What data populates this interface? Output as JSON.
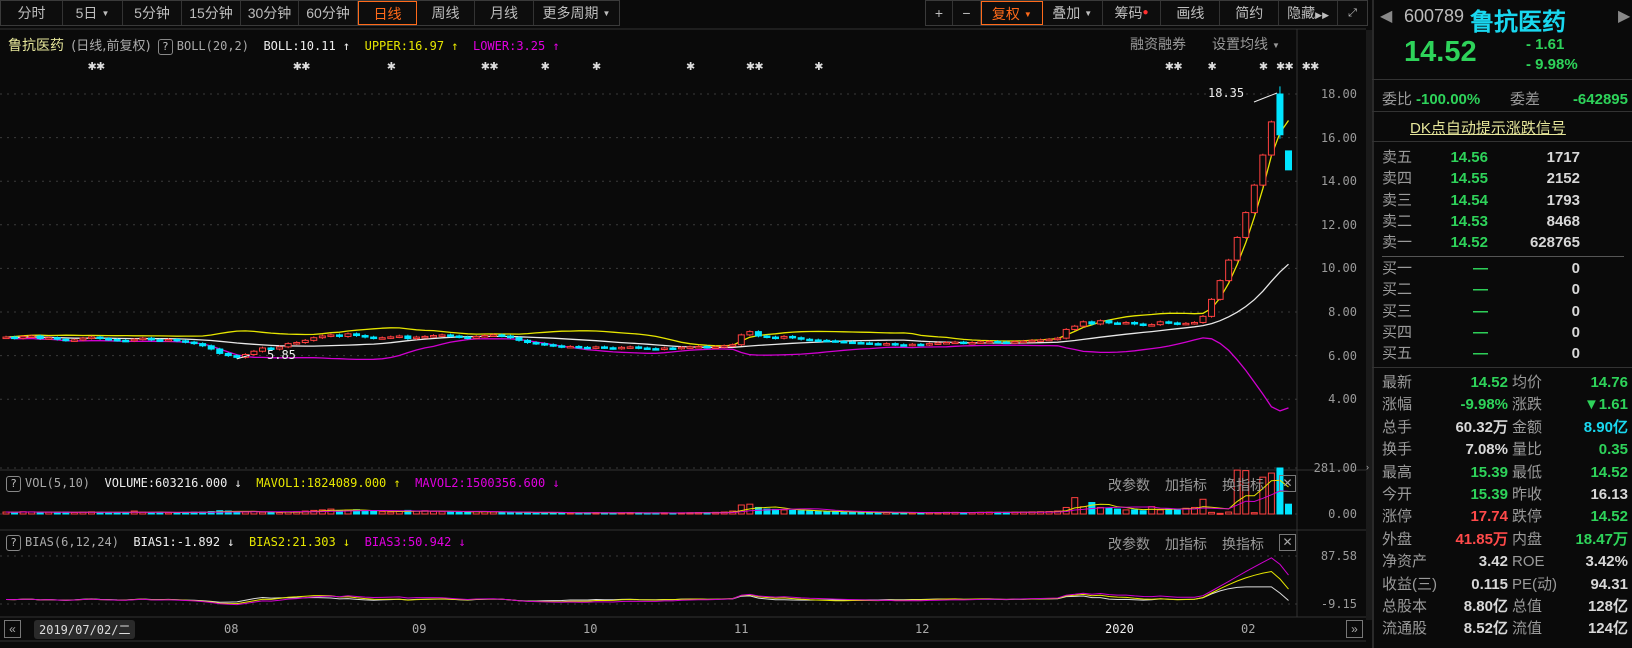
{
  "toolbar": {
    "tabs": [
      "分时",
      "5日",
      "5分钟",
      "15分钟",
      "30分钟",
      "60分钟",
      "日线",
      "周线",
      "月线",
      "更多周期"
    ],
    "active": "日线",
    "right": [
      "+",
      "−",
      "复权",
      "叠加",
      "筹码",
      "画线",
      "简约",
      "隐藏"
    ]
  },
  "main": {
    "stock_name": "鲁抗医药",
    "mode": "(日线,前复权)",
    "boll_name": "BOLL(20,2)",
    "boll": "BOLL:10.11 ↑",
    "upper": "UPPER:16.97 ↑",
    "lower": "LOWER:3.25 ↑",
    "rzrq": "融资融券",
    "set_ma": "设置均线",
    "price_axis": [
      "18.00",
      "16.00",
      "14.00",
      "12.00",
      "10.00",
      "8.00",
      "6.00",
      "4.00"
    ],
    "high_label": "18.35",
    "low_label": "5.85"
  },
  "vol": {
    "name": "VOL(5,10)",
    "volume": "VOLUME:603216.000 ↓",
    "mavol1": "MAVOL1:1824089.000 ↑",
    "mavol2": "MAVOL2:1500356.600 ↓",
    "axis": [
      "281.00",
      "0.00"
    ],
    "buttons": [
      "改参数",
      "加指标",
      "换指标"
    ]
  },
  "bias": {
    "name": "BIAS(6,12,24)",
    "bias1": "BIAS1:-1.892 ↓",
    "bias2": "BIAS2:21.303 ↓",
    "bias3": "BIAS3:50.942 ↓",
    "axis": [
      "87.58",
      "-9.15"
    ],
    "buttons": [
      "改参数",
      "加指标",
      "换指标"
    ]
  },
  "dates": {
    "cursor": "2019/07/02/二",
    "months": [
      "08",
      "09",
      "10",
      "11",
      "12",
      "2020",
      "02"
    ]
  },
  "colors": {
    "up": "#ff4040",
    "down": "#00e5ff",
    "mid": "#e8e8e8",
    "upper": "#e6e600",
    "lower": "#d000d0"
  },
  "chart_data": {
    "type": "candlestick",
    "title": "鲁抗医药 日线",
    "ylim": [
      3,
      19
    ],
    "closes": [
      6.85,
      6.8,
      6.88,
      6.9,
      6.78,
      6.82,
      6.75,
      6.7,
      6.72,
      6.8,
      6.85,
      6.78,
      6.74,
      6.7,
      6.68,
      6.75,
      6.8,
      6.72,
      6.7,
      6.74,
      6.68,
      6.62,
      6.55,
      6.45,
      6.3,
      6.1,
      6.0,
      5.92,
      6.05,
      6.2,
      6.35,
      6.3,
      6.4,
      6.55,
      6.6,
      6.7,
      6.82,
      6.9,
      6.95,
      6.88,
      7.0,
      6.92,
      6.85,
      6.8,
      6.82,
      6.86,
      6.9,
      6.78,
      6.85,
      6.88,
      6.92,
      6.95,
      6.9,
      6.85,
      6.8,
      6.88,
      6.92,
      6.95,
      6.9,
      6.82,
      6.7,
      6.6,
      6.55,
      6.5,
      6.45,
      6.4,
      6.42,
      6.38,
      6.35,
      6.4,
      6.36,
      6.33,
      6.38,
      6.4,
      6.35,
      6.32,
      6.3,
      6.35,
      6.33,
      6.38,
      6.4,
      6.42,
      6.38,
      6.4,
      6.45,
      6.5,
      6.95,
      7.1,
      6.9,
      6.85,
      6.8,
      6.88,
      6.82,
      6.75,
      6.72,
      6.7,
      6.68,
      6.65,
      6.62,
      6.6,
      6.58,
      6.55,
      6.52,
      6.55,
      6.5,
      6.48,
      6.52,
      6.5,
      6.55,
      6.58,
      6.6,
      6.62,
      6.58,
      6.6,
      6.63,
      6.65,
      6.62,
      6.6,
      6.64,
      6.66,
      6.7,
      6.72,
      6.75,
      6.8,
      7.2,
      7.35,
      7.55,
      7.45,
      7.6,
      7.5,
      7.48,
      7.52,
      7.45,
      7.4,
      7.42,
      7.55,
      7.5,
      7.45,
      7.48,
      7.52,
      7.8,
      8.58,
      9.44,
      10.38,
      11.42,
      12.56,
      13.82,
      15.2,
      16.72,
      16.13,
      14.52
    ],
    "last_ohlc": [
      [
        18.0,
        18.35,
        15.95,
        16.13
      ],
      [
        15.39,
        15.39,
        14.52,
        14.52
      ]
    ],
    "volumes_wan": [
      12,
      10,
      14,
      13,
      9,
      11,
      10,
      12,
      9,
      11,
      13,
      10,
      9,
      8,
      10,
      18,
      11,
      9,
      10,
      8,
      9,
      10,
      11,
      12,
      15,
      20,
      18,
      14,
      12,
      16,
      11,
      10,
      9,
      12,
      14,
      18,
      22,
      25,
      30,
      20,
      24,
      26,
      18,
      16,
      14,
      12,
      15,
      22,
      18,
      20,
      16,
      14,
      15,
      13,
      12,
      15,
      14,
      12,
      10,
      9,
      8,
      10,
      9,
      8,
      7,
      8,
      7,
      6,
      7,
      8,
      7,
      6,
      7,
      8,
      7,
      6,
      6,
      7,
      6,
      7,
      8,
      9,
      8,
      10,
      12,
      18,
      55,
      60,
      40,
      30,
      28,
      25,
      22,
      20,
      18,
      16,
      14,
      13,
      12,
      11,
      10,
      9,
      8,
      9,
      8,
      7,
      8,
      8,
      9,
      9,
      10,
      10,
      9,
      9,
      10,
      11,
      10,
      10,
      11,
      12,
      13,
      14,
      15,
      18,
      40,
      100,
      45,
      70,
      40,
      35,
      30,
      25,
      25,
      20,
      45,
      25,
      30,
      30,
      35,
      40,
      90,
      10,
      4,
      12,
      268,
      265,
      8,
      225,
      250,
      281,
      60
    ]
  },
  "quote": {
    "code": "600789",
    "name": "鲁抗医药",
    "price": "14.52",
    "change": "- 1.61",
    "pct": "- 9.98%",
    "wb_label": "委比",
    "wb": "-100.00%",
    "wc_label": "委差",
    "wc": "-642895",
    "dk": "DK点自动提示涨跌信号",
    "asks": [
      [
        "卖五",
        "14.56",
        "1717"
      ],
      [
        "卖四",
        "14.55",
        "2152"
      ],
      [
        "卖三",
        "14.54",
        "1793"
      ],
      [
        "卖二",
        "14.53",
        "8468"
      ],
      [
        "卖一",
        "14.52",
        "628765"
      ]
    ],
    "bids": [
      [
        "买一",
        "—",
        "0"
      ],
      [
        "买二",
        "—",
        "0"
      ],
      [
        "买三",
        "—",
        "0"
      ],
      [
        "买四",
        "—",
        "0"
      ],
      [
        "买五",
        "—",
        "0"
      ]
    ],
    "stats": [
      [
        "最新",
        "14.52",
        "均价",
        "14.76"
      ],
      [
        "涨幅",
        "-9.98%",
        "涨跌",
        "▼1.61"
      ],
      [
        "总手",
        "60.32万",
        "金额",
        "8.90亿"
      ],
      [
        "换手",
        "7.08%",
        "量比",
        "0.35"
      ],
      [
        "最高",
        "15.39",
        "最低",
        "14.52"
      ],
      [
        "今开",
        "15.39",
        "昨收",
        "16.13"
      ],
      [
        "涨停",
        "17.74",
        "跌停",
        "14.52"
      ],
      [
        "外盘",
        "41.85万",
        "内盘",
        "18.47万"
      ],
      [
        "净资产",
        "3.42",
        "ROE",
        "3.42%"
      ],
      [
        "收益(三)",
        "0.115",
        "PE(动)",
        "94.31"
      ],
      [
        "总股本",
        "8.80亿",
        "总值",
        "128亿"
      ],
      [
        "流通股",
        "8.52亿",
        "流值",
        "124亿"
      ]
    ]
  }
}
